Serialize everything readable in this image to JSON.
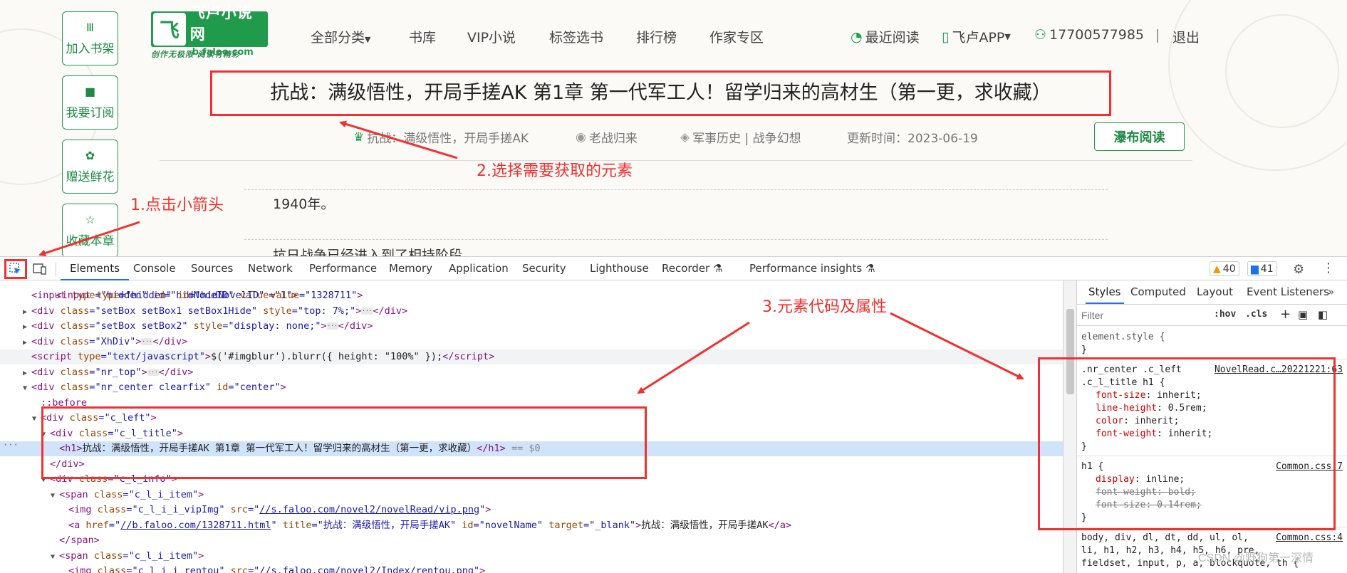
{
  "sidebar": [
    {
      "label": "加入书架",
      "icon": "bookshelf-icon",
      "glyph": "Ⅲ"
    },
    {
      "label": "我要订阅",
      "icon": "bookmark-icon",
      "glyph": "■"
    },
    {
      "label": "赠送鲜花",
      "icon": "flower-icon",
      "glyph": "✿"
    },
    {
      "label": "收藏本章",
      "icon": "star-icon",
      "glyph": "☆"
    }
  ],
  "logo": {
    "mark": "飞",
    "name": "飞卢小说网",
    "url": "b.faloo.com",
    "slogan": "创作无极限  阅读有精彩"
  },
  "nav": [
    "全部分类",
    "书库",
    "VIP小说",
    "标签选书",
    "排行榜",
    "作家专区"
  ],
  "user_nav": {
    "recent": "最近阅读",
    "app": "飞卢APP",
    "phone": "17700577985",
    "divider": "|",
    "logout": "退出"
  },
  "chapter": {
    "title": "抗战：满级悟性，开局手搓AK 第1章 第一代军工人！留学归来的高材生（第一更，求收藏）",
    "book": "抗战：满级悟性，开局手搓AK",
    "author": "老战归来",
    "category": "军事历史 | 战争幻想",
    "updated": "更新时间：2023-06-19",
    "read_button": "瀑布阅读",
    "line1": "1940年。",
    "line2": "抗日战争已经进入到了相持阶段"
  },
  "annotations": {
    "step1": "1.点击小箭头",
    "step2": "2.选择需要获取的元素",
    "step3": "3.元素代码及属性"
  },
  "devtools": {
    "tabs": [
      "Elements",
      "Console",
      "Sources",
      "Network",
      "Performance",
      "Memory",
      "Application",
      "Security",
      "Lighthouse",
      "Recorder",
      "Performance insights"
    ],
    "warnings": "40",
    "messages": "41"
  },
  "code_lines": [
    {
      "indent": 0,
      "tri": "",
      "html": "<span class='tag'>&lt;input</span> <span class='attr'>type</span>=<span class='val'>\"hidden\"</span> <span class='attr'>id</span>=<span class='val'>\"hidNodeID\"</span> <span class='attr'>value</span>=<span class='val'>\"1\"</span><span class='tag'>&gt;</span>"
    },
    {
      "indent": 0,
      "tri": "▶",
      "html": "<span class='tag'>&lt;div</span> <span class='attr'>class</span>=<span class='val'>\"setBox setBox1 setBox1Hide\"</span> <span class='attr'>style</span>=<span class='val'>\"top: 7%;\"</span><span class='tag'>&gt;</span><span class='ellip'>···</span><span class='tag'>&lt;/div&gt;</span>"
    },
    {
      "indent": 0,
      "tri": "▶",
      "html": "<span class='tag'>&lt;div</span> <span class='attr'>class</span>=<span class='val'>\"setBox setBox2\"</span> <span class='attr'>style</span>=<span class='val'>\"display: none;\"</span><span class='tag'>&gt;</span><span class='ellip'>···</span><span class='tag'>&lt;/div&gt;</span>"
    },
    {
      "indent": 0,
      "tri": "▶",
      "html": "<span class='tag'>&lt;div</span> <span class='attr'>class</span>=<span class='val'>\"XhDiv\"</span><span class='tag'>&gt;</span><span class='ellip'>···</span><span class='tag'>&lt;/div&gt;</span>"
    },
    {
      "indent": 0,
      "tri": "",
      "soft": true,
      "html": "<span class='tag'>&lt;script</span> <span class='attr'>type</span>=<span class='val'>\"text/javascript\"</span><span class='tag'>&gt;</span><span class='txt'>$('#imgblur').blurr({ height: \"100%\" });</span><span class='tag'>&lt;/script&gt;</span>"
    },
    {
      "indent": 0,
      "tri": "▶",
      "html": "<span class='tag'>&lt;div</span> <span class='attr'>class</span>=<span class='val'>\"nr_top\"</span><span class='tag'>&gt;</span><span class='ellip'>···</span><span class='tag'>&lt;/div&gt;</span>"
    },
    {
      "indent": 0,
      "tri": "▼",
      "html": "<span class='tag'>&lt;div</span> <span class='attr'>class</span>=<span class='val'>\"nr_center clearfix\"</span> <span class='attr'>id</span>=<span class='val'>\"center\"</span><span class='tag'>&gt;</span>"
    },
    {
      "indent": 1,
      "tri": "",
      "html": "<span class='tag'>::before</span>"
    },
    {
      "indent": 1,
      "tri": "▼",
      "html": "<span class='tag'>&lt;div</span> <span class='attr'>class</span>=<span class='val'>\"c_left\"</span><span class='tag'>&gt;</span>"
    },
    {
      "indent": 2,
      "tri": "▼",
      "html": "<span class='tag'>&lt;div</span> <span class='attr'>class</span>=<span class='val'>\"c_l_title\"</span><span class='tag'>&gt;</span>"
    },
    {
      "indent": 3,
      "tri": "",
      "hl": true,
      "html": "<span class='tag'>&lt;h1&gt;</span><span class='txt'>抗战：满级悟性，开局手搓AK 第1章 第一代军工人！留学归来的高材生（第一更，求收藏）</span><span class='tag'>&lt;/h1&gt;</span> <span class='dim'>== $0</span>"
    },
    {
      "indent": 2,
      "tri": "",
      "html": "<span class='tag'>&lt;/div&gt;</span>"
    },
    {
      "indent": 2,
      "tri": "▼",
      "html": "<span class='tag'>&lt;div</span> <span class='attr'>class</span>=<span class='val'>\"c_l_info\"</span><span class='tag'>&gt;</span>"
    },
    {
      "indent": 3,
      "tri": "▼",
      "html": "<span class='tag'>&lt;span</span> <span class='attr'>class</span>=<span class='val'>\"c_l_i_item\"</span><span class='tag'>&gt;</span>"
    },
    {
      "indent": 4,
      "tri": "",
      "html": "<span class='tag'>&lt;img</span> <span class='attr'>class</span>=<span class='val'>\"c_l_i_i_vipImg\"</span> <span class='attr'>src</span>=<span class='val'>\"</span><span class='link'>//s.faloo.com/novel2/novelRead/vip.png</span><span class='val'>\"</span><span class='tag'>&gt;</span>"
    },
    {
      "indent": 4,
      "tri": "",
      "html": "<span class='tag'>&lt;a</span> <span class='attr'>href</span>=<span class='val'>\"</span><span class='link'>//b.faloo.com/1328711.html</span><span class='val'>\"</span> <span class='attr'>title</span>=<span class='val'>\"抗战：满级悟性，开局手搓AK\"</span> <span class='attr'>id</span>=<span class='val'>\"novelName\"</span> <span class='attr'>target</span>=<span class='val'>\"_blank\"</span><span class='tag'>&gt;</span><span class='txt'>抗战：满级悟性，开局手搓AK</span><span class='tag'>&lt;/a&gt;</span>"
    },
    {
      "indent": 3,
      "tri": "",
      "html": "<span class='tag'>&lt;/span&gt;</span>"
    },
    {
      "indent": 3,
      "tri": "▼",
      "html": "<span class='tag'>&lt;span</span> <span class='attr'>class</span>=<span class='val'>\"c_l_i_item\"</span><span class='tag'>&gt;</span>"
    },
    {
      "indent": 4,
      "tri": "",
      "html": "<span class='tag'>&lt;img</span> <span class='attr'>class</span>=<span class='val'>\"c_l_i_i_rentou\"</span> <span class='attr'>src</span>=<span class='val'>\"</span><span class='link'>//s.faloo.com/novel2/Index/rentou.png</span><span class='val'>\"</span><span class='tag'>&gt;</span>"
    }
  ],
  "styles_panel": {
    "tabs": [
      "Styles",
      "Computed",
      "Layout",
      "Event Listeners"
    ],
    "filter_placeholder": "Filter",
    "hov": ":hov",
    "cls": ".cls",
    "element_style": "element.style {",
    "close": "}",
    "rule1_selector_a": ".nr_center .c_left",
    "rule1_selector_b": ".c_l_title h1 {",
    "rule1_source": "NovelRead.c…20221221:63",
    "rule1_props": [
      {
        "name": "font-size",
        "value": "inherit;"
      },
      {
        "name": "line-height",
        "value": "0.5rem;"
      },
      {
        "name": "color",
        "value": "inherit;"
      },
      {
        "name": "font-weight",
        "value": "inherit;"
      }
    ],
    "rule2_selector": "h1 {",
    "rule2_source": "Common.css:7",
    "rule2_props": [
      {
        "name": "display",
        "value": "inline;"
      },
      {
        "name": "font-weight",
        "value": "bold;"
      },
      {
        "name": "font-size",
        "value": "0.14rem;"
      }
    ],
    "rule3_source": "Common.css:4",
    "rule3_line1": "body, div, dl, dt, dd, ul, ol,",
    "rule3_line2": "li, h1, h2, h3, h4, h5, h6, pre,",
    "rule3_line3": "fieldset, input, p, a, blockquote, th {"
  },
  "watermark": "CSDN @野狗第一深情",
  "colors": {
    "brand_green": "#1f9b4b",
    "annotation_red": "#f0312e",
    "devtools_blue": "#1a73e8"
  }
}
